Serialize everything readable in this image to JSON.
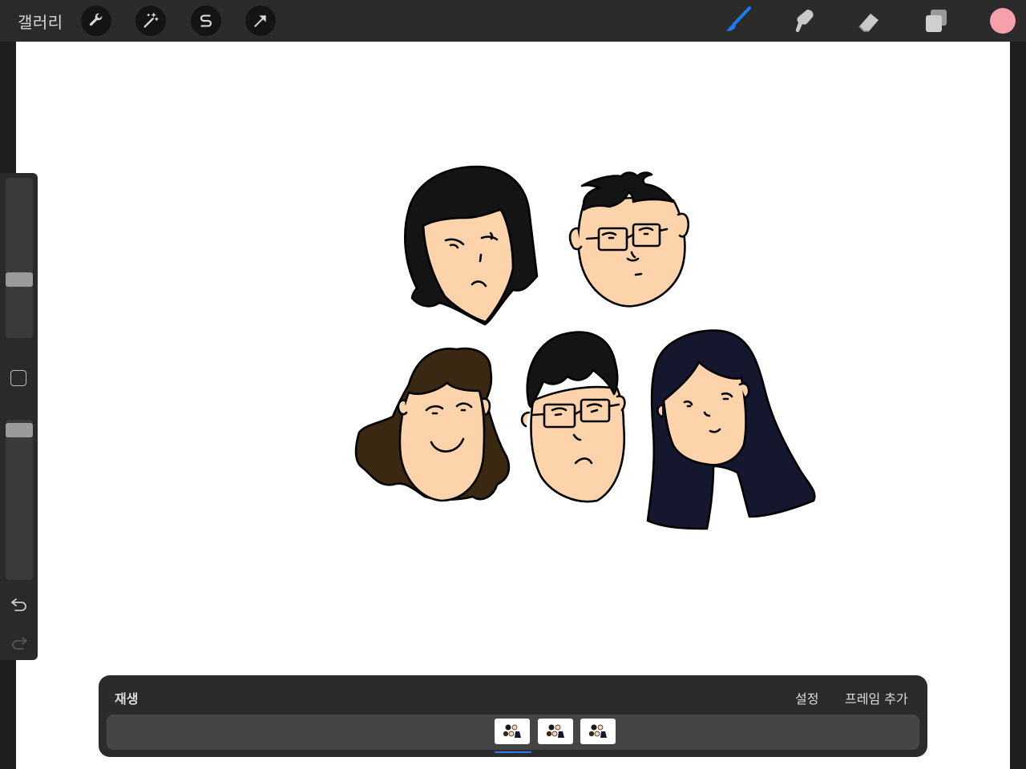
{
  "topbar": {
    "gallery_label": "갤러리",
    "tools_left": [
      {
        "name": "actions",
        "icon": "wrench-icon"
      },
      {
        "name": "adjustments",
        "icon": "magic-wand-icon"
      },
      {
        "name": "selection",
        "icon": "selection-s-icon"
      },
      {
        "name": "transform",
        "icon": "arrow-icon"
      }
    ],
    "tools_right": [
      {
        "name": "brush",
        "icon": "brush-icon",
        "active": true
      },
      {
        "name": "smudge",
        "icon": "smudge-icon"
      },
      {
        "name": "eraser",
        "icon": "eraser-icon"
      },
      {
        "name": "layers",
        "icon": "layers-icon"
      }
    ],
    "current_color": "#f6a0ab",
    "active_tool_color": "#1f7bf2"
  },
  "sidebar": {
    "brush_size_level": 0.36,
    "opacity_level": 0.02,
    "icons": [
      "modifier-square-icon",
      "undo-icon",
      "redo-icon"
    ]
  },
  "animation_assist": {
    "play_label": "재생",
    "settings_label": "설정",
    "add_frame_label": "프레임 추가",
    "frames": [
      {
        "index": 1,
        "selected": true
      },
      {
        "index": 2,
        "selected": false
      },
      {
        "index": 3,
        "selected": false
      }
    ]
  },
  "canvas": {
    "background": "#ffffff",
    "skin_color": "#fdd3ac",
    "hair_colors": [
      "#1a1a1a",
      "#3a2812",
      "#14172e"
    ]
  }
}
